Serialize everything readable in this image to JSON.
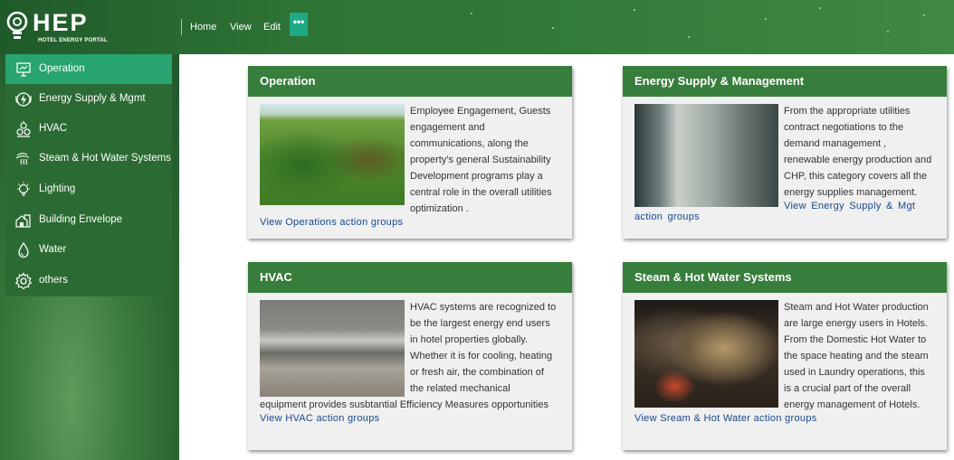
{
  "brand": {
    "name": "HEP",
    "subtitle": "HOTEL ENERGY PORTAL"
  },
  "topnav": {
    "home": "Home",
    "view": "View",
    "edit": "Edit",
    "more": "•••"
  },
  "sidebar": {
    "items": [
      {
        "label": "Operation",
        "icon": "operation-icon",
        "active": true
      },
      {
        "label": "Energy Supply & Mgmt",
        "icon": "energy-icon",
        "active": false
      },
      {
        "label": "HVAC",
        "icon": "hvac-icon",
        "active": false
      },
      {
        "label": "Steam & Hot Water Systems",
        "icon": "steam-icon",
        "active": false
      },
      {
        "label": "Lighting",
        "icon": "lightbulb-icon",
        "active": false
      },
      {
        "label": "Building Envelope",
        "icon": "building-icon",
        "active": false
      },
      {
        "label": "Water",
        "icon": "water-drop-icon",
        "active": false
      },
      {
        "label": "others",
        "icon": "gear-icon",
        "active": false
      }
    ]
  },
  "cards": [
    {
      "title": "Operation",
      "text": "Employee Engagement, Guests engagement and communications, along the property's general Sustainability Development programs play a central role in the overall utilities optimization .",
      "link": "View Operations action groups"
    },
    {
      "title": "Energy Supply  & Management",
      "text": "From the appropriate utilities contract negotiations to the demand management , renewable energy production and CHP, this category covers all the energy supplies management.",
      "link": "View  Energy  Supply & Mgt action groups"
    },
    {
      "title": "HVAC",
      "text": "HVAC systems are recognized to be the largest energy end users in hotel properties globally. Whether it is for cooling, heating or fresh air, the combination of the related mechanical equipment provides susbtantial Efficiency Measures opportunities",
      "link": "View HVAC action groups"
    },
    {
      "title": "Steam & Hot Water Systems",
      "text": "Steam and Hot Water production are large energy users in Hotels. From the Domestic Hot Water to the space heating and the steam used in Laundry operations, this is a crucial part of the overall energy management of Hotels.",
      "link": "View Sream & Hot Water action groups"
    }
  ],
  "colors": {
    "header_green": "#2d7335",
    "sidebar_green": "#2b6a33",
    "active_item": "#27a46f",
    "card_header": "#377d3c",
    "link_blue": "#17488c"
  }
}
